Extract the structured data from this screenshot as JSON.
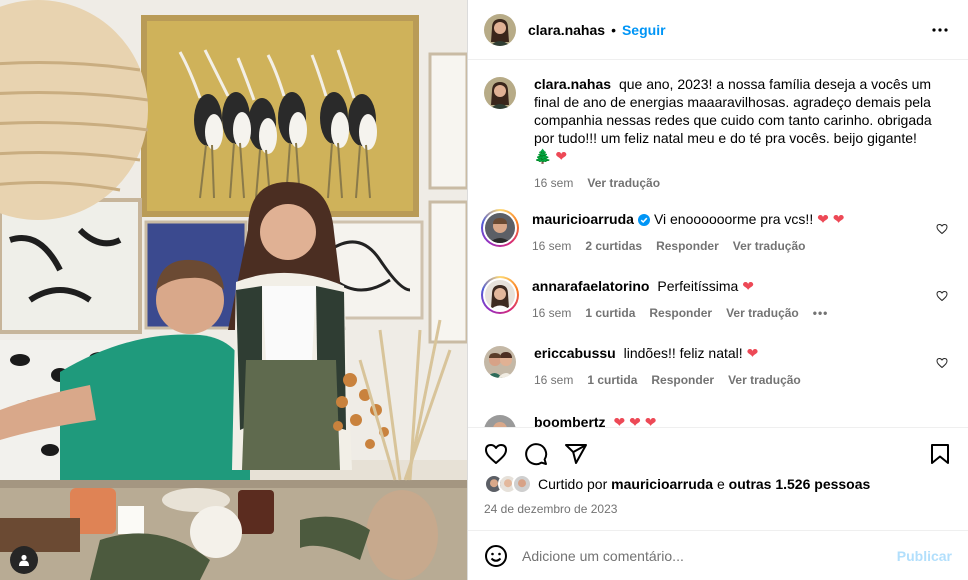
{
  "post": {
    "username": "clara.nahas",
    "follow_label": "Seguir",
    "separator": "•",
    "caption": {
      "username": "clara.nahas",
      "text": "que ano, 2023! a nossa família deseja a vocês um final de ano de energias maaaravilhosas. agradeço demais pela companhia nessas redes que cuido com tanto carinho. obrigada por tudo!!! um feliz natal meu e do té pra vocês. beijo gigante!",
      "emojis": "🌲 ❤",
      "time": "16 sem",
      "translate": "Ver tradução"
    },
    "comments": [
      {
        "username": "mauricioarruda",
        "verified": true,
        "text": "Vi enoooooorme pra vcs!!",
        "emoji": "❤ ❤",
        "time": "16 sem",
        "likes": "2 curtidas",
        "reply": "Responder",
        "translate": "Ver tradução",
        "story_ring": true
      },
      {
        "username": "annarafaelatorino",
        "text": "Perfeitíssima",
        "emoji": "❤",
        "time": "16 sem",
        "likes": "1 curtida",
        "reply": "Responder",
        "translate": "Ver tradução",
        "more": "•••",
        "story_ring": true
      },
      {
        "username": "ericcabussu",
        "text": "lindões!! feliz natal!",
        "emoji": "❤",
        "time": "16 sem",
        "likes": "1 curtida",
        "reply": "Responder",
        "translate": "Ver tradução"
      },
      {
        "username": "boombertz",
        "text": "",
        "emoji": "❤ ❤ ❤"
      }
    ],
    "likes": {
      "prefix": "Curtido por",
      "user": "mauricioarruda",
      "connector": "e",
      "others": "outras 1.526 pessoas"
    },
    "date": "24 de dezembro de 2023",
    "add_comment_placeholder": "Adicione um comentário...",
    "publish_label": "Publicar"
  },
  "icons": {
    "more": "more-horizontal-icon",
    "like": "heart-icon",
    "comment": "comment-icon",
    "share": "share-icon",
    "save": "bookmark-icon",
    "emoji": "emoji-icon",
    "tagged": "user-tag-icon"
  },
  "colors": {
    "link": "#0095f6",
    "muted": "#737373",
    "heart": "#ed4956",
    "publish_disabled": "#b2dffc"
  }
}
